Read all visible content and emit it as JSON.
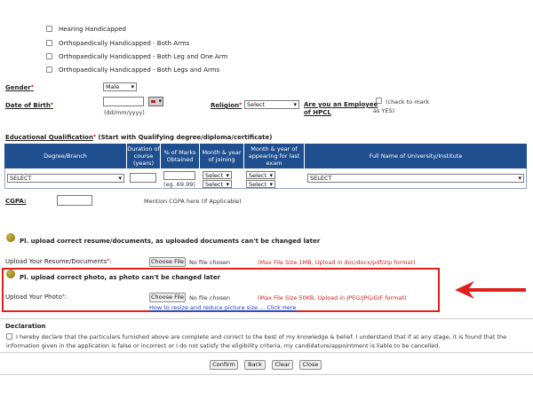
{
  "disability_options": [
    "Hearing Handicapped",
    "Orthopaedically Handicapped - Both Arms",
    "Orthopaedically Handicapped - Both Leg and One Arm",
    "Orthopaedically Handicapped - Both Legs and Arms"
  ],
  "gender": {
    "label": "Gender",
    "value": "Male"
  },
  "dob": {
    "label": "Date of Birth",
    "hint": "(dd/mm/yyyy)"
  },
  "religion": {
    "label": "Religion",
    "value": "Select"
  },
  "employee": {
    "label_line1": "Are you an Employee",
    "label_line2": "of HPCL",
    "hint_line1": "(check to mark",
    "hint_line2": "as YES)"
  },
  "education": {
    "title": "Educational Qualification",
    "subtitle": "(Start with Qualifying degree/diploma/certificate)",
    "headers": [
      "Degree/Branch",
      "Duration of course (years)",
      "% of Marks Obtained",
      "Month & year of joining",
      "Month & year of appearing for last exam",
      "Full Name of University/Institute"
    ],
    "degree_value": "SELECT",
    "marks_hint": "(eg. 69.99)",
    "join_month": "Select",
    "join_year": "Select",
    "last_month": "Select",
    "last_year": "Select",
    "university_value": "SELECT"
  },
  "cgpa": {
    "label": "CGPA:",
    "hint": "Mention CGPA here (If Applicable)"
  },
  "resume_section": {
    "title": "Pl. upload correct resume/documents, as uploaded documents can't be changed later",
    "label": "Upload Your Resume/Documents",
    "button": "Choose File",
    "status": "No file chosen",
    "note": "(Max File Size 1MB, Upload in doc/docx/pdf/zip format)"
  },
  "photo_section": {
    "title": "Pl. upload correct photo, as photo can't be changed later",
    "label": "Upload Your Photo",
    "button": "Choose File",
    "status": "No file chosen",
    "note": "(Max File Size 50KB, Upload in JPEG/JPG/GIF format)",
    "link": "How to resize and reduce picture size ... Click Here"
  },
  "declaration": {
    "title": "Declaration",
    "text_line1": "I hereby declare that the particulars furnished above are complete and correct to the best of my knowledge & belief. I understand that if at any stage, it is found that the",
    "text_line2": "information given in the application is false or incorrect or I do not satisfy the eligibility criteria, my candidature/appointment is liable to be cancelled."
  },
  "actions": {
    "confirm": "Confirm",
    "back": "Back",
    "clear": "Clear",
    "close": "Close"
  },
  "colors": {
    "table_header": "#1f4f8f",
    "highlight_box": "#e0201c",
    "arrow": "#e0201c",
    "link": "#1a3fbf"
  }
}
